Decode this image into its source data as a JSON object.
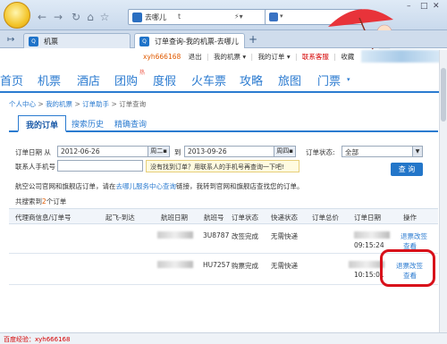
{
  "browser": {
    "url_text": "去哪儿",
    "url_suffix": "t",
    "tabs": [
      {
        "label": "机票",
        "active": false
      },
      {
        "label": "订单查询-我的机票-去哪儿",
        "active": true
      }
    ],
    "new_tab": "+"
  },
  "header": {
    "username": "xyh666168",
    "logout": "退出",
    "my_tickets": "我的机票",
    "my_orders": "我的订单",
    "contact": "联系客服",
    "favorite": "收藏"
  },
  "nav": {
    "items": [
      "首页",
      "机票",
      "酒店",
      "团购",
      "度假",
      "火车票",
      "攻略",
      "旅图",
      "门票"
    ],
    "badge": "热"
  },
  "breadcrumb": [
    "个人中心",
    "我的机票",
    "订单助手",
    "订单查询"
  ],
  "subtabs": [
    "我的订单",
    "搜索历史",
    "精确查询"
  ],
  "filters": {
    "date_label": "订单日期 从",
    "from_date": "2012-06-26",
    "from_day": "周二",
    "to_label": "到",
    "to_date": "2013-09-26",
    "to_day": "周四",
    "status_label": "订单状态:",
    "status_value": "全部",
    "phone_label": "联系人手机号",
    "hint": "没有找到订单？用联系人的手机号再查询一下吧!",
    "query_button": "查 询"
  },
  "notice": {
    "prefix": "航空公司官网和旗舰店订单，请在",
    "link": "去哪儿服务中心查询",
    "suffix": "链接，我转到官网和旗舰店查找您的订单。"
  },
  "result": {
    "prefix": "共搜索到",
    "count": "2",
    "suffix": "个订单"
  },
  "table": {
    "headers": [
      "代理商信息/订单号",
      "起飞-到达",
      "航班日期",
      "航班号",
      "订单状态",
      "快递状态",
      "订单总价",
      "订单日期",
      "操作"
    ],
    "rows": [
      {
        "flight_no": "3U8787",
        "status": "改签完成",
        "express": "无需快递",
        "time": "09:15:24",
        "actions": [
          "退票改签",
          "查看"
        ]
      },
      {
        "flight_no": "HU7257",
        "status": "购票完成",
        "express": "无需快递",
        "time": "10:15:01",
        "actions": [
          "退票改签",
          "查看"
        ]
      }
    ]
  },
  "statusbar": {
    "text": "百度经验：xyh666168"
  },
  "colors": {
    "accent": "#2b7bd0",
    "highlight": "#d8101a"
  }
}
